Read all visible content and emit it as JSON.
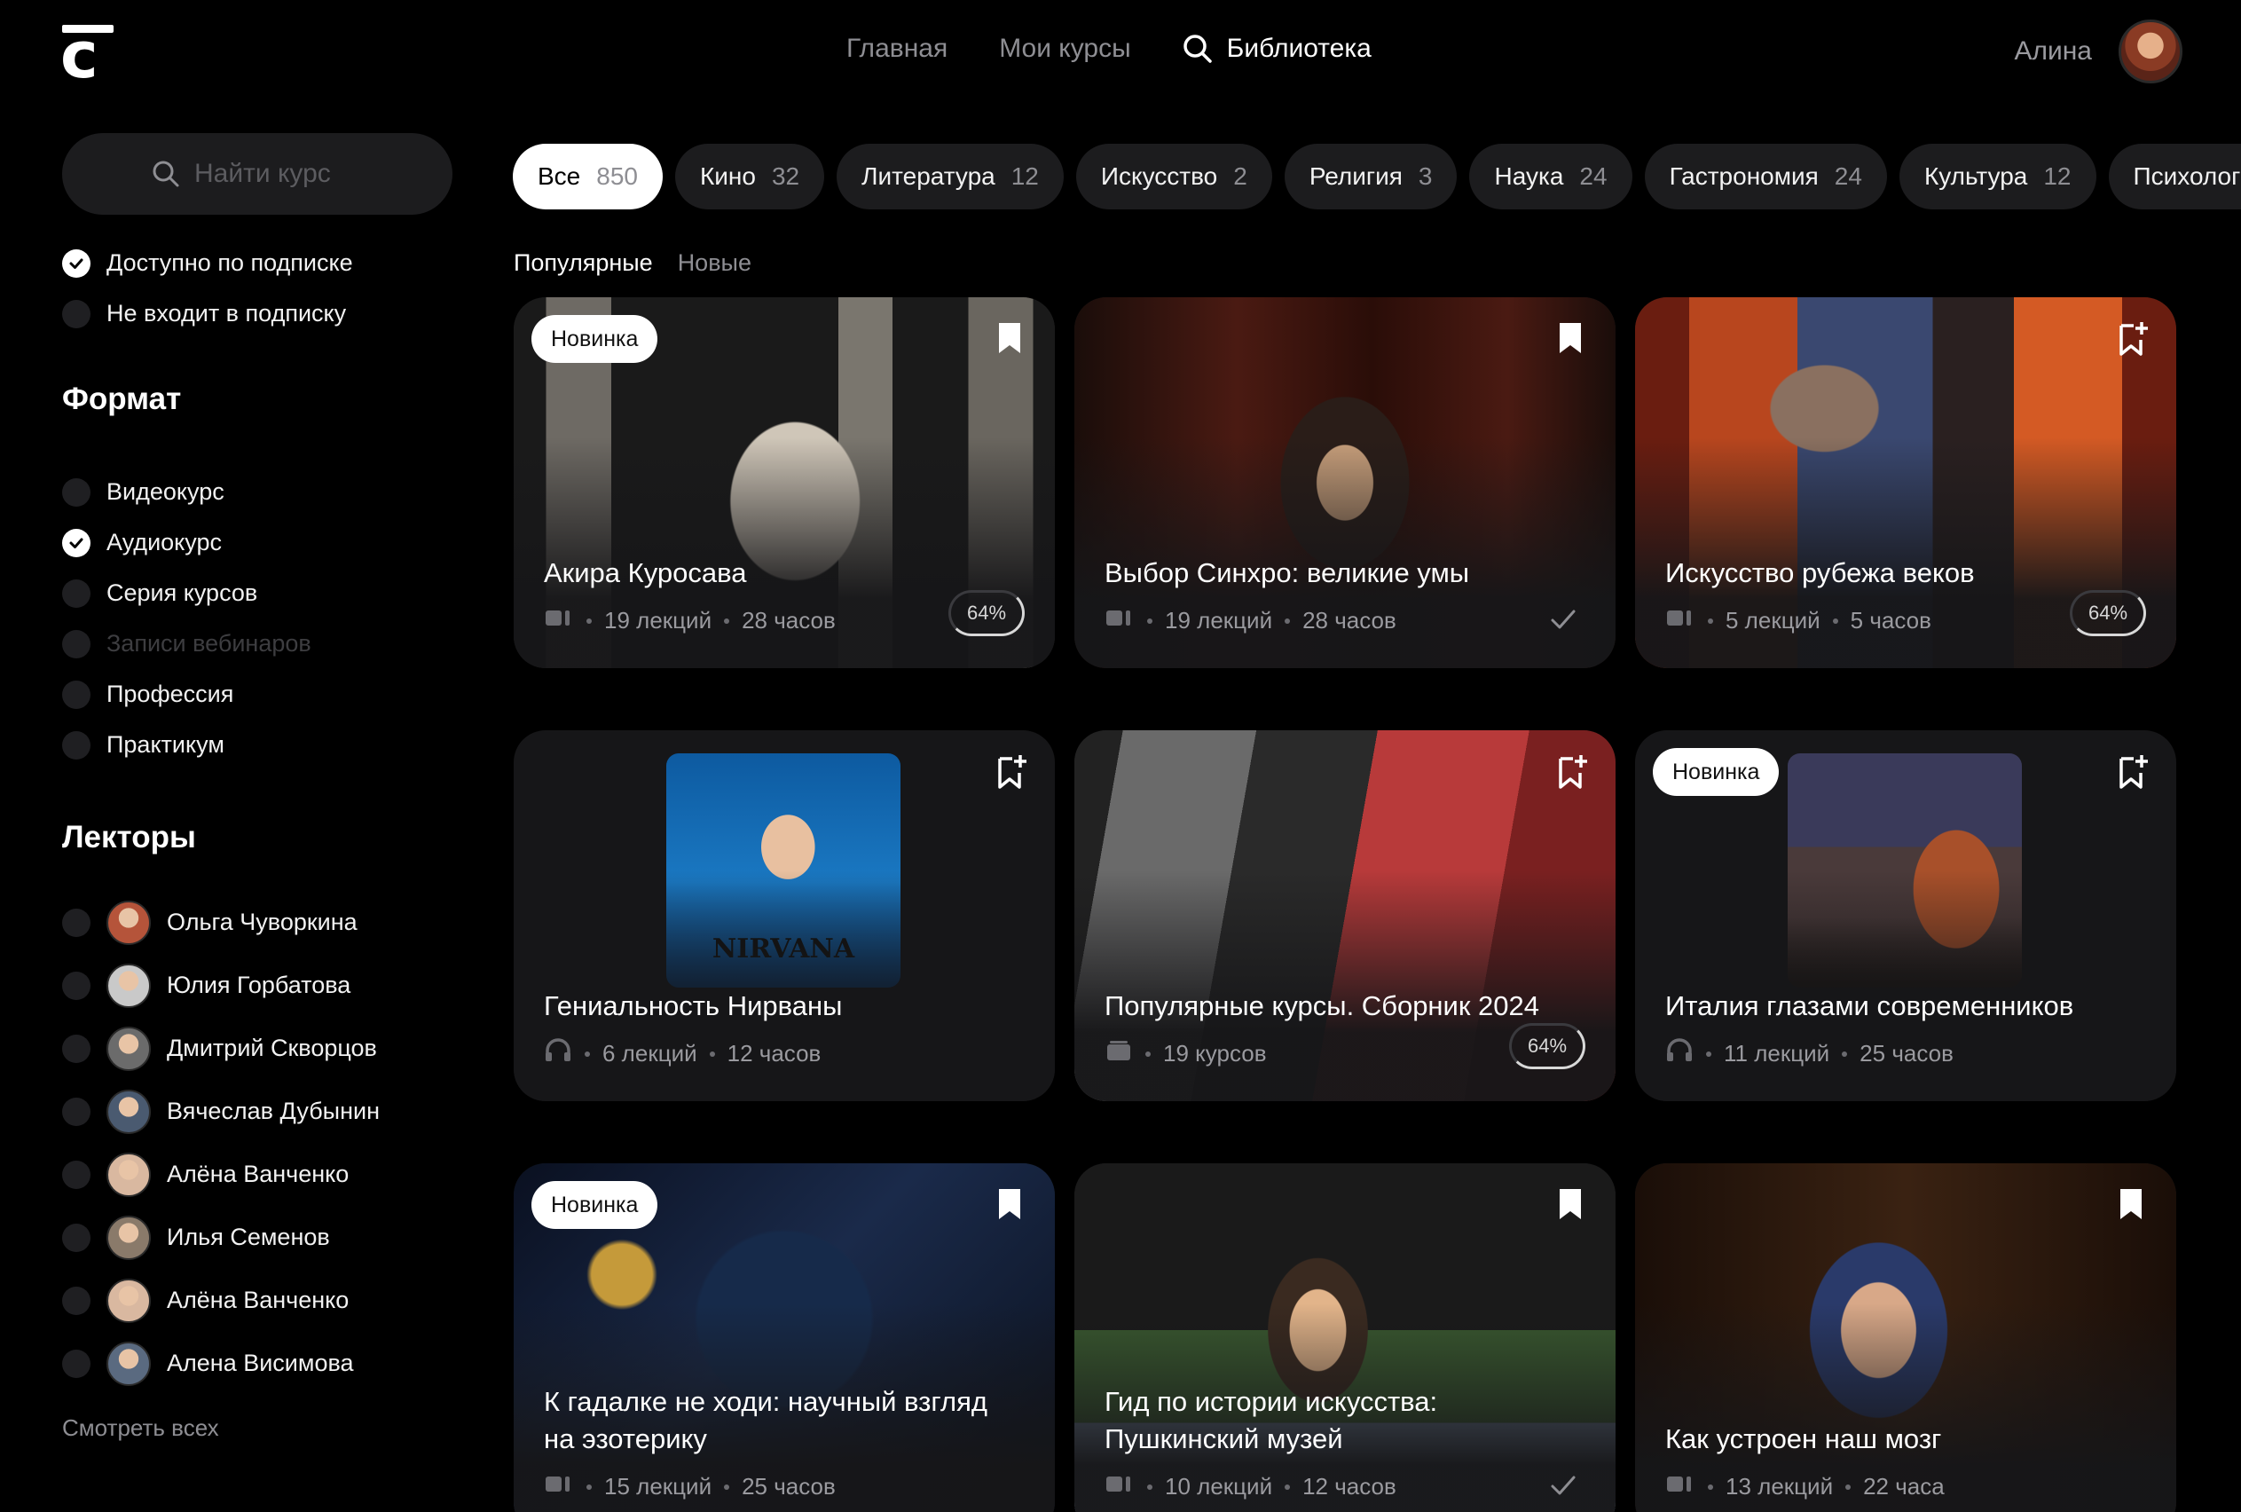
{
  "header": {
    "nav": [
      "Главная",
      "Мои курсы",
      "Библиотека"
    ],
    "user_name": "Алина"
  },
  "sidebar": {
    "search_placeholder": "Найти курс",
    "subscription": [
      {
        "label": "Доступно по подписке",
        "checked": true
      },
      {
        "label": "Не входит в подписку",
        "checked": false
      }
    ],
    "format_title": "Формат",
    "formats": [
      {
        "label": "Видеокурс",
        "checked": false,
        "disabled": false
      },
      {
        "label": "Аудиокурс",
        "checked": true,
        "disabled": false
      },
      {
        "label": "Серия курсов",
        "checked": false,
        "disabled": false
      },
      {
        "label": "Записи вебинаров",
        "checked": false,
        "disabled": true
      },
      {
        "label": "Профессия",
        "checked": false,
        "disabled": false
      },
      {
        "label": "Практикум",
        "checked": false,
        "disabled": false
      }
    ],
    "lecturers_title": "Лекторы",
    "lecturers": [
      {
        "name": "Ольга Чуворкина",
        "color": "#b5543a"
      },
      {
        "name": "Юлия Горбатова",
        "color": "#c9c9c9"
      },
      {
        "name": "Дмитрий Скворцов",
        "color": "#6b6b6b"
      },
      {
        "name": "Вячеслав Дубынин",
        "color": "#4a5a70"
      },
      {
        "name": "Алёна Ванченко",
        "color": "#d9b8a0"
      },
      {
        "name": "Илья Семенов",
        "color": "#8a7a6a"
      },
      {
        "name": "Алёна Ванченко",
        "color": "#d9b8a0"
      },
      {
        "name": "Алена Висимова",
        "color": "#5a6a80"
      }
    ],
    "see_all": "Смотреть всех"
  },
  "categories": [
    {
      "label": "Все",
      "count": "850",
      "active": true
    },
    {
      "label": "Кино",
      "count": "32"
    },
    {
      "label": "Литература",
      "count": "12"
    },
    {
      "label": "Искусство",
      "count": "2"
    },
    {
      "label": "Религия",
      "count": "3"
    },
    {
      "label": "Наука",
      "count": "24"
    },
    {
      "label": "Гастрономия",
      "count": "24"
    },
    {
      "label": "Культура",
      "count": "12"
    },
    {
      "label": "Психология",
      "count": ""
    }
  ],
  "sort": {
    "active": "Популярные",
    "other": "Новые"
  },
  "cards": [
    {
      "title": "Акира Куросава",
      "badge": "Новинка",
      "meta": [
        "19 лекций",
        "28 часов"
      ],
      "progress": "64%",
      "type": "video",
      "bookmarked": true
    },
    {
      "title": "Выбор Синхро: великие умы",
      "badge": "",
      "meta": [
        "19 лекций",
        "28 часов"
      ],
      "progress": "",
      "done": true,
      "type": "video",
      "bookmarked": true
    },
    {
      "title": "Искусство рубежа веков",
      "badge": "",
      "meta": [
        "5 лекций",
        "5 часов"
      ],
      "progress": "64%",
      "type": "video",
      "bookmarked": false
    },
    {
      "title": "Гениальность Нирваны",
      "badge": "",
      "meta": [
        "6 лекций",
        "12 часов"
      ],
      "progress": "",
      "type": "audio",
      "bookmarked": false,
      "art_text": "NIRVANA"
    },
    {
      "title": "Популярные курсы. Сборник 2024",
      "badge": "",
      "meta": [
        "19 курсов"
      ],
      "progress": "64%",
      "type": "series",
      "bookmarked": false
    },
    {
      "title": "Италия глазами современников",
      "badge": "Новинка",
      "meta": [
        "11 лекций",
        "25 часов"
      ],
      "progress": "",
      "type": "audio",
      "bookmarked": false
    },
    {
      "title": "К гадалке не ходи: научный взгляд на эзотерику",
      "badge": "Новинка",
      "meta": [
        "15 лекций",
        "25 часов"
      ],
      "progress": "",
      "type": "video",
      "bookmarked": true
    },
    {
      "title": "Гид по истории искусства: Пушкинский музей",
      "badge": "",
      "meta": [
        "10 лекций",
        "12 часов"
      ],
      "progress": "",
      "done": true,
      "type": "video",
      "bookmarked": true
    },
    {
      "title": "Как устроен наш мозг",
      "badge": "",
      "meta": [
        "13 лекций",
        "22 часа"
      ],
      "progress": "",
      "type": "video",
      "bookmarked": true
    }
  ]
}
